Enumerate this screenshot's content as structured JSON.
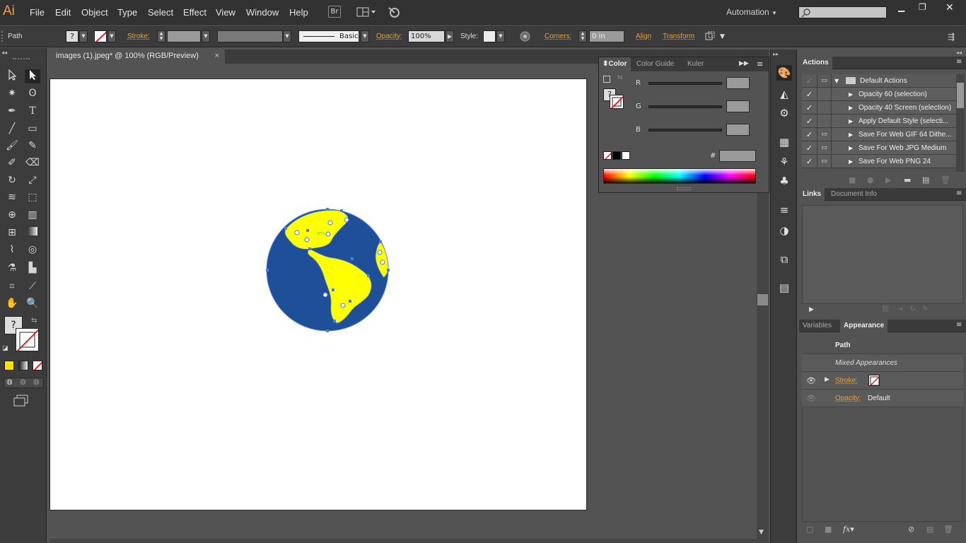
{
  "app": {
    "logo": "Ai"
  },
  "menu": [
    "File",
    "Edit",
    "Object",
    "Type",
    "Select",
    "Effect",
    "View",
    "Window",
    "Help"
  ],
  "toolbar_right": {
    "bridge": "Br",
    "workspace": "Automation"
  },
  "control_bar": {
    "selection_label": "Path",
    "stroke_label": "Stroke:",
    "stroke_style": "Basic",
    "opacity_label": "Opacity:",
    "opacity_value": "100%",
    "style_label": "Style:",
    "corners_label": "Corners:",
    "corners_value": "0 in",
    "align_label": "Align",
    "transform_label": "Transform"
  },
  "document": {
    "tab_title": "images (1).jpeg* @ 100% (RGB/Preview)",
    "close": "×"
  },
  "color_panel": {
    "tabs": [
      "Color",
      "Color Guide",
      "Kuler"
    ],
    "channels": [
      "R",
      "G",
      "B"
    ],
    "hex_label": "#",
    "fill_unknown": "?"
  },
  "tools_panel": {
    "fill_unknown": "?"
  },
  "actions_panel": {
    "tab": "Actions",
    "folder": "Default Actions",
    "items": [
      "Opacity 60 (selection)",
      "Opacity 40 Screen (selection)",
      "Apply Default Style (selecti...",
      "Save For Web GIF 64 Dithe...",
      "Save For Web JPG Medium",
      "Save For Web PNG 24"
    ]
  },
  "links_panel": {
    "tabs": [
      "Links",
      "Document Info"
    ]
  },
  "appearance_panel": {
    "tabs": [
      "Variables",
      "Appearance"
    ],
    "object": "Path",
    "mixed": "Mixed Appearances",
    "stroke_label": "Stroke:",
    "opacity_label": "Opacity:",
    "opacity_value": "Default",
    "fx": "fx"
  },
  "colors": {
    "globe_blue": "#1f4f99",
    "land_yellow": "#ffff00",
    "selection_blue": "#4a7ee0",
    "accent_orange": "#f0a030"
  }
}
